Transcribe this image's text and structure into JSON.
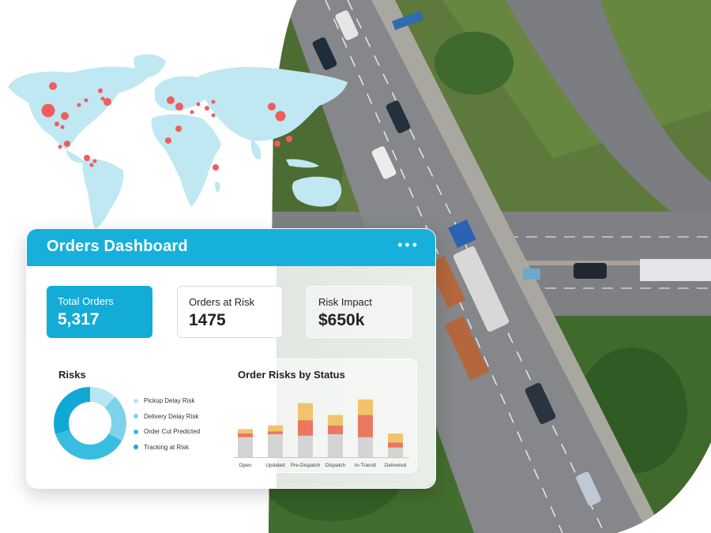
{
  "dashboard": {
    "title": "Orders Dashboard",
    "menu_icon": "more-horizontal-icon",
    "kpis": [
      {
        "label": "Total Orders",
        "value": "5,317"
      },
      {
        "label": "Orders at Risk",
        "value": "1475"
      },
      {
        "label": "Risk Impact",
        "value": "$650k"
      }
    ],
    "risks": {
      "title": "Risks",
      "legend": [
        {
          "label": "Pickup Delay Risk",
          "color": "#b9e6f2"
        },
        {
          "label": "Delivery Delay Risk",
          "color": "#7ed3ea"
        },
        {
          "label": "Order Cut Predicted",
          "color": "#37bde0"
        },
        {
          "label": "Tracking at Risk",
          "color": "#10a9d6"
        }
      ]
    },
    "order_risks": {
      "title": "Order Risks by Status"
    }
  },
  "chart_data": [
    {
      "type": "pie",
      "title": "Risks",
      "labels": [
        "Pickup Delay Risk",
        "Delivery Delay Risk",
        "Order Cut Predicted",
        "Tracking at Risk"
      ],
      "values": [
        12,
        21,
        37,
        30
      ],
      "donut": true
    },
    {
      "type": "bar",
      "stacked": true,
      "title": "Order Risks by Status",
      "categories": [
        "Open",
        "Updated",
        "Pre-Dispatch",
        "Dispatch",
        "In-Transit",
        "Delivered"
      ],
      "series": [
        {
          "values": [
            27,
            31,
            29,
            31,
            27,
            13
          ],
          "color": "#d4d4d4"
        },
        {
          "values": [
            5,
            4,
            21,
            12,
            30,
            7
          ],
          "color": "#e97861"
        },
        {
          "values": [
            6,
            8,
            23,
            14,
            21,
            12
          ],
          "color": "#f1c36c"
        }
      ],
      "ylim": [
        0,
        80
      ]
    }
  ],
  "colors": {
    "brand": "#17b0db",
    "map_land": "#bfe8f2",
    "map_marker": "#f05e5b"
  }
}
